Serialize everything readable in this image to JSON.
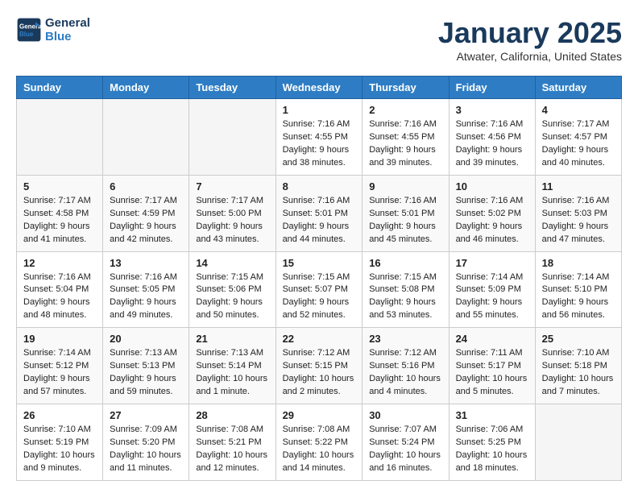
{
  "header": {
    "logo_line1": "General",
    "logo_line2": "Blue",
    "month": "January 2025",
    "location": "Atwater, California, United States"
  },
  "weekdays": [
    "Sunday",
    "Monday",
    "Tuesday",
    "Wednesday",
    "Thursday",
    "Friday",
    "Saturday"
  ],
  "weeks": [
    [
      {
        "day": "",
        "info": ""
      },
      {
        "day": "",
        "info": ""
      },
      {
        "day": "",
        "info": ""
      },
      {
        "day": "1",
        "info": "Sunrise: 7:16 AM\nSunset: 4:55 PM\nDaylight: 9 hours and 38 minutes."
      },
      {
        "day": "2",
        "info": "Sunrise: 7:16 AM\nSunset: 4:55 PM\nDaylight: 9 hours and 39 minutes."
      },
      {
        "day": "3",
        "info": "Sunrise: 7:16 AM\nSunset: 4:56 PM\nDaylight: 9 hours and 39 minutes."
      },
      {
        "day": "4",
        "info": "Sunrise: 7:17 AM\nSunset: 4:57 PM\nDaylight: 9 hours and 40 minutes."
      }
    ],
    [
      {
        "day": "5",
        "info": "Sunrise: 7:17 AM\nSunset: 4:58 PM\nDaylight: 9 hours and 41 minutes."
      },
      {
        "day": "6",
        "info": "Sunrise: 7:17 AM\nSunset: 4:59 PM\nDaylight: 9 hours and 42 minutes."
      },
      {
        "day": "7",
        "info": "Sunrise: 7:17 AM\nSunset: 5:00 PM\nDaylight: 9 hours and 43 minutes."
      },
      {
        "day": "8",
        "info": "Sunrise: 7:16 AM\nSunset: 5:01 PM\nDaylight: 9 hours and 44 minutes."
      },
      {
        "day": "9",
        "info": "Sunrise: 7:16 AM\nSunset: 5:01 PM\nDaylight: 9 hours and 45 minutes."
      },
      {
        "day": "10",
        "info": "Sunrise: 7:16 AM\nSunset: 5:02 PM\nDaylight: 9 hours and 46 minutes."
      },
      {
        "day": "11",
        "info": "Sunrise: 7:16 AM\nSunset: 5:03 PM\nDaylight: 9 hours and 47 minutes."
      }
    ],
    [
      {
        "day": "12",
        "info": "Sunrise: 7:16 AM\nSunset: 5:04 PM\nDaylight: 9 hours and 48 minutes."
      },
      {
        "day": "13",
        "info": "Sunrise: 7:16 AM\nSunset: 5:05 PM\nDaylight: 9 hours and 49 minutes."
      },
      {
        "day": "14",
        "info": "Sunrise: 7:15 AM\nSunset: 5:06 PM\nDaylight: 9 hours and 50 minutes."
      },
      {
        "day": "15",
        "info": "Sunrise: 7:15 AM\nSunset: 5:07 PM\nDaylight: 9 hours and 52 minutes."
      },
      {
        "day": "16",
        "info": "Sunrise: 7:15 AM\nSunset: 5:08 PM\nDaylight: 9 hours and 53 minutes."
      },
      {
        "day": "17",
        "info": "Sunrise: 7:14 AM\nSunset: 5:09 PM\nDaylight: 9 hours and 55 minutes."
      },
      {
        "day": "18",
        "info": "Sunrise: 7:14 AM\nSunset: 5:10 PM\nDaylight: 9 hours and 56 minutes."
      }
    ],
    [
      {
        "day": "19",
        "info": "Sunrise: 7:14 AM\nSunset: 5:12 PM\nDaylight: 9 hours and 57 minutes."
      },
      {
        "day": "20",
        "info": "Sunrise: 7:13 AM\nSunset: 5:13 PM\nDaylight: 9 hours and 59 minutes."
      },
      {
        "day": "21",
        "info": "Sunrise: 7:13 AM\nSunset: 5:14 PM\nDaylight: 10 hours and 1 minute."
      },
      {
        "day": "22",
        "info": "Sunrise: 7:12 AM\nSunset: 5:15 PM\nDaylight: 10 hours and 2 minutes."
      },
      {
        "day": "23",
        "info": "Sunrise: 7:12 AM\nSunset: 5:16 PM\nDaylight: 10 hours and 4 minutes."
      },
      {
        "day": "24",
        "info": "Sunrise: 7:11 AM\nSunset: 5:17 PM\nDaylight: 10 hours and 5 minutes."
      },
      {
        "day": "25",
        "info": "Sunrise: 7:10 AM\nSunset: 5:18 PM\nDaylight: 10 hours and 7 minutes."
      }
    ],
    [
      {
        "day": "26",
        "info": "Sunrise: 7:10 AM\nSunset: 5:19 PM\nDaylight: 10 hours and 9 minutes."
      },
      {
        "day": "27",
        "info": "Sunrise: 7:09 AM\nSunset: 5:20 PM\nDaylight: 10 hours and 11 minutes."
      },
      {
        "day": "28",
        "info": "Sunrise: 7:08 AM\nSunset: 5:21 PM\nDaylight: 10 hours and 12 minutes."
      },
      {
        "day": "29",
        "info": "Sunrise: 7:08 AM\nSunset: 5:22 PM\nDaylight: 10 hours and 14 minutes."
      },
      {
        "day": "30",
        "info": "Sunrise: 7:07 AM\nSunset: 5:24 PM\nDaylight: 10 hours and 16 minutes."
      },
      {
        "day": "31",
        "info": "Sunrise: 7:06 AM\nSunset: 5:25 PM\nDaylight: 10 hours and 18 minutes."
      },
      {
        "day": "",
        "info": ""
      }
    ]
  ]
}
